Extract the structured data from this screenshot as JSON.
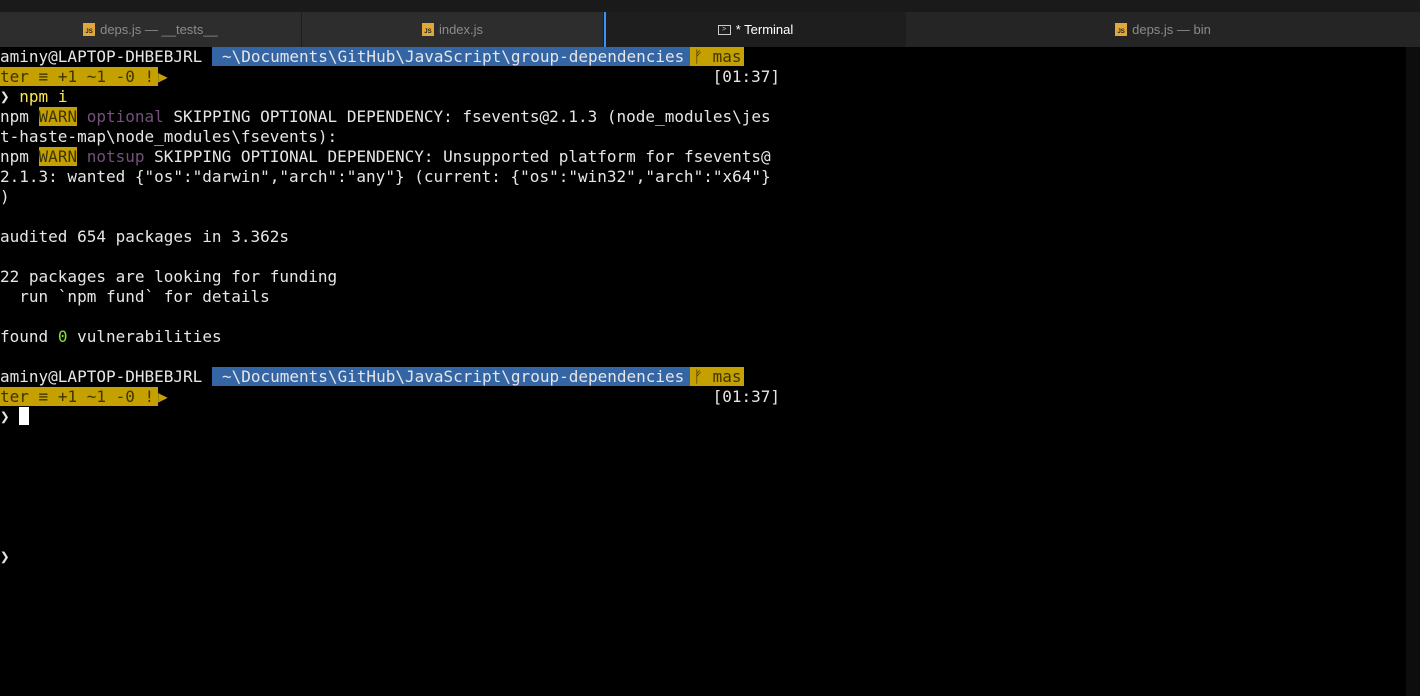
{
  "tabs": [
    {
      "label": "deps.js — __tests__",
      "icon": "js-file-icon",
      "active": false
    },
    {
      "label": "index.js",
      "icon": "js-file-icon",
      "active": false
    },
    {
      "label": "* Terminal",
      "icon": "terminal-icon",
      "active": true
    },
    {
      "label": "deps.js — bin",
      "icon": "js-file-icon",
      "active": false
    }
  ],
  "js_icon_text": "JS",
  "prompt": {
    "user": "aminy@LAPTOP-DHBEBJRL",
    "path": "~\\Documents\\GitHub\\JavaScript\\group-dependencies",
    "branch_start": "mas",
    "branch_end": "ter",
    "git_status": "≡ +1 ~1 -0 !",
    "time": "[01:37]",
    "chevron": "❯"
  },
  "command": "npm i",
  "output": {
    "warn1": {
      "prefix": "npm",
      "level": "WARN",
      "tag": "optional",
      "text1": "SKIPPING OPTIONAL DEPENDENCY: fsevents@2.1.3 (node_modules\\jes",
      "text2": "t-haste-map\\node_modules\\fsevents):"
    },
    "warn2": {
      "prefix": "npm",
      "level": "WARN",
      "tag": "notsup",
      "text1": "SKIPPING OPTIONAL DEPENDENCY: Unsupported platform for fsevents@",
      "text2": "2.1.3: wanted {\"os\":\"darwin\",\"arch\":\"any\"} (current: {\"os\":\"win32\",\"arch\":\"x64\"}",
      "text3": ")"
    },
    "audited": "audited 654 packages in 3.362s",
    "funding": "22 packages are looking for funding",
    "fund_hint": "  run `npm fund` for details",
    "found_prefix": "found",
    "found_count": "0",
    "found_suffix": "vulnerabilities"
  },
  "colors": {
    "path_bg": "#3465a4",
    "git_bg": "#c4a000",
    "warn_bg": "#c4a000",
    "command": "#fce94f",
    "tag": "#75507b",
    "success": "#8ae234",
    "active_tab_border": "#3794ff"
  }
}
